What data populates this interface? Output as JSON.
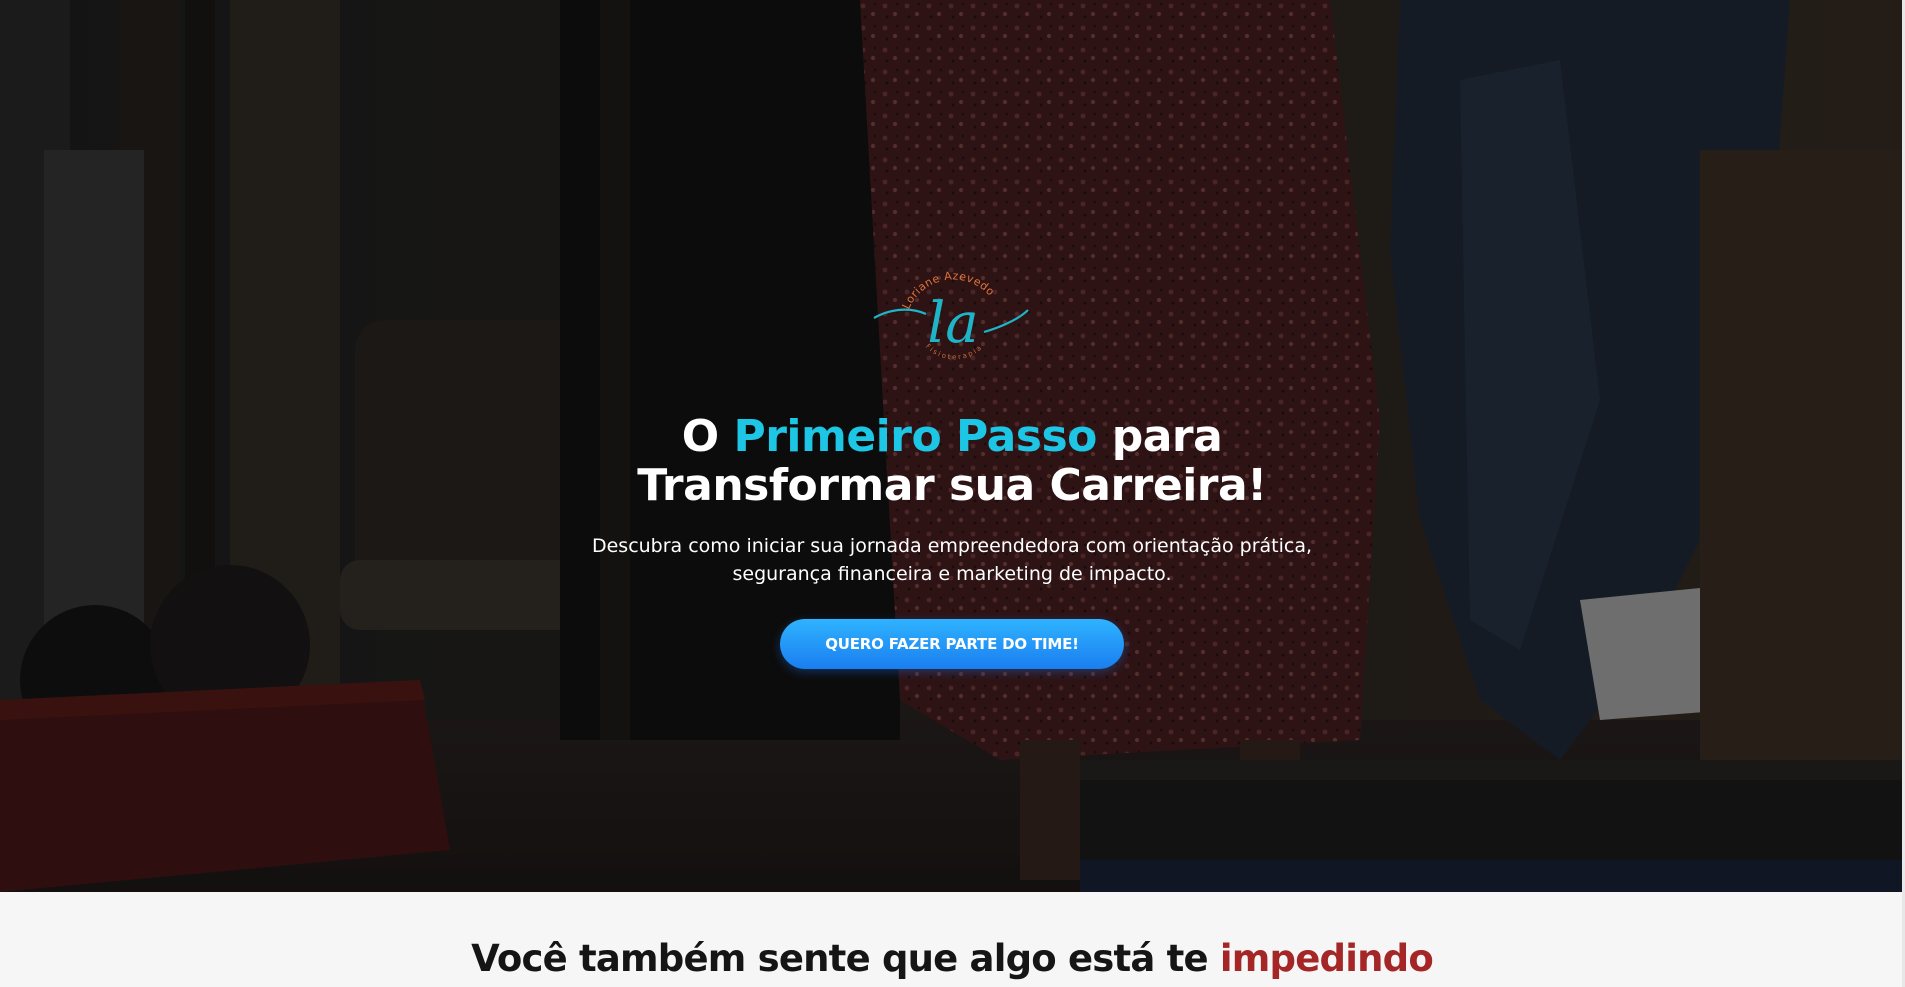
{
  "hero": {
    "logo": {
      "name_text": "Loriane Azevedo",
      "monogram": "la",
      "profession_text": "Fisioterapia",
      "monogram_color": "#1fb5c9",
      "ring_text_color": "#e0733a"
    },
    "headline": {
      "part1": "O ",
      "accent": "Primeiro Passo",
      "part2": " para",
      "line2": "Transformar sua Carreira!"
    },
    "subtitle": {
      "line1": "Descubra como iniciar sua jornada empreendedora com orientação prática,",
      "line2": "segurança financeira e marketing de impacto."
    },
    "cta_label": "QUERO FAZER PARTE DO TIME!"
  },
  "problem_section": {
    "title_part1": "Você também sente que algo está te ",
    "title_accent": "impedindo"
  },
  "colors": {
    "accent_cyan": "#1ec6e6",
    "cta_blue_top": "#2fb3ff",
    "cta_blue_bottom": "#1a7ef0",
    "accent_red": "#a52626",
    "section_background": "#f6f6f6"
  }
}
